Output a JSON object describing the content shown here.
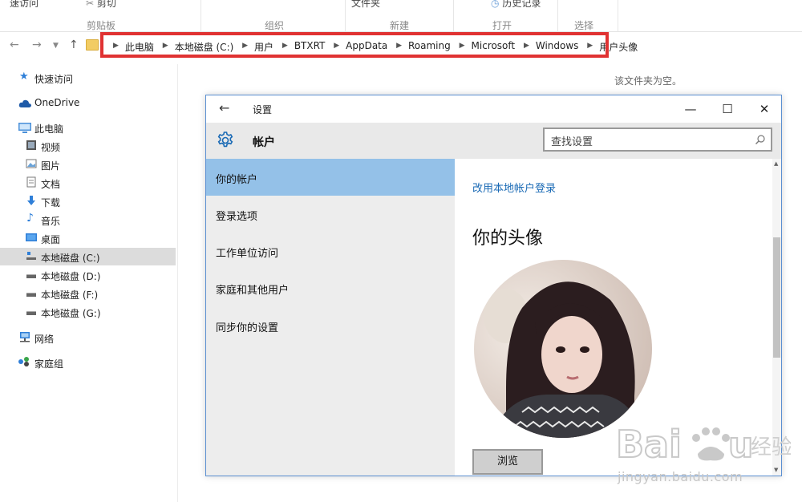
{
  "ribbon": {
    "items": [
      "速访问",
      "剪切",
      "文件夹",
      "历史记录"
    ],
    "groups": [
      "剪贴板",
      "组织",
      "新建",
      "打开",
      "选择"
    ]
  },
  "address": {
    "crumbs": [
      "此电脑",
      "本地磁盘 (C:)",
      "用户",
      "BTXRT",
      "AppData",
      "Roaming",
      "Microsoft",
      "Windows",
      "用户头像"
    ]
  },
  "nav": {
    "items": [
      "快速访问",
      "OneDrive",
      "此电脑",
      "视频",
      "图片",
      "文档",
      "下载",
      "音乐",
      "桌面",
      "本地磁盘 (C:)",
      "本地磁盘 (D:)",
      "本地磁盘 (F:)",
      "本地磁盘 (G:)",
      "网络",
      "家庭组"
    ],
    "selected": "本地磁盘 (C:)"
  },
  "main": {
    "empty_message": "该文件夹为空。"
  },
  "settings": {
    "window_title": "设置",
    "header": "帐户",
    "search_placeholder": "查找设置",
    "sidebar": [
      "你的帐户",
      "登录选项",
      "工作单位访问",
      "家庭和其他用户",
      "同步你的设置"
    ],
    "active": "你的帐户",
    "link": "改用本地帐户登录",
    "section_title": "你的头像",
    "browse_button": "浏览"
  },
  "watermark": {
    "url": "jingyan.baidu.com"
  },
  "icons": [
    "back-arrow-icon",
    "forward-arrow-icon",
    "recent-chevron-icon",
    "up-arrow-icon",
    "folder-icon",
    "star-icon",
    "cloud-icon",
    "computer-icon",
    "video-icon",
    "picture-icon",
    "document-icon",
    "download-icon",
    "music-icon",
    "desktop-icon",
    "drive-icon",
    "network-icon",
    "homegroup-icon",
    "gear-icon",
    "search-icon",
    "minimize-icon",
    "maximize-icon",
    "close-icon"
  ],
  "colors": {
    "address_highlight": "#e03232",
    "selection": "#94c1e8",
    "link": "#1a6ab5",
    "window_border": "#5a8fd1"
  }
}
